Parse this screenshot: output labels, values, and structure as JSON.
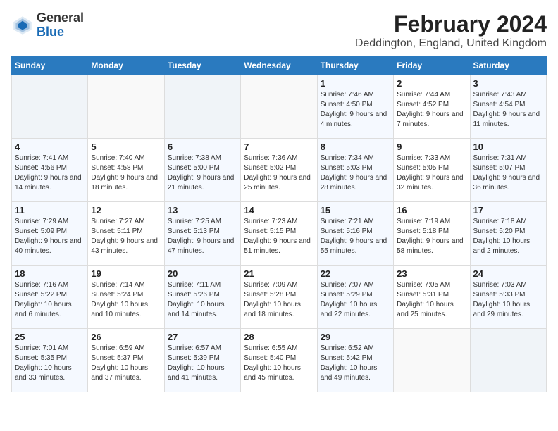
{
  "logo": {
    "general": "General",
    "blue": "Blue"
  },
  "title": {
    "month_year": "February 2024",
    "location": "Deddington, England, United Kingdom"
  },
  "days_of_week": [
    "Sunday",
    "Monday",
    "Tuesday",
    "Wednesday",
    "Thursday",
    "Friday",
    "Saturday"
  ],
  "weeks": [
    [
      {
        "day": "",
        "info": ""
      },
      {
        "day": "",
        "info": ""
      },
      {
        "day": "",
        "info": ""
      },
      {
        "day": "",
        "info": ""
      },
      {
        "day": "1",
        "info": "Sunrise: 7:46 AM\nSunset: 4:50 PM\nDaylight: 9 hours and 4 minutes."
      },
      {
        "day": "2",
        "info": "Sunrise: 7:44 AM\nSunset: 4:52 PM\nDaylight: 9 hours and 7 minutes."
      },
      {
        "day": "3",
        "info": "Sunrise: 7:43 AM\nSunset: 4:54 PM\nDaylight: 9 hours and 11 minutes."
      }
    ],
    [
      {
        "day": "4",
        "info": "Sunrise: 7:41 AM\nSunset: 4:56 PM\nDaylight: 9 hours and 14 minutes."
      },
      {
        "day": "5",
        "info": "Sunrise: 7:40 AM\nSunset: 4:58 PM\nDaylight: 9 hours and 18 minutes."
      },
      {
        "day": "6",
        "info": "Sunrise: 7:38 AM\nSunset: 5:00 PM\nDaylight: 9 hours and 21 minutes."
      },
      {
        "day": "7",
        "info": "Sunrise: 7:36 AM\nSunset: 5:02 PM\nDaylight: 9 hours and 25 minutes."
      },
      {
        "day": "8",
        "info": "Sunrise: 7:34 AM\nSunset: 5:03 PM\nDaylight: 9 hours and 28 minutes."
      },
      {
        "day": "9",
        "info": "Sunrise: 7:33 AM\nSunset: 5:05 PM\nDaylight: 9 hours and 32 minutes."
      },
      {
        "day": "10",
        "info": "Sunrise: 7:31 AM\nSunset: 5:07 PM\nDaylight: 9 hours and 36 minutes."
      }
    ],
    [
      {
        "day": "11",
        "info": "Sunrise: 7:29 AM\nSunset: 5:09 PM\nDaylight: 9 hours and 40 minutes."
      },
      {
        "day": "12",
        "info": "Sunrise: 7:27 AM\nSunset: 5:11 PM\nDaylight: 9 hours and 43 minutes."
      },
      {
        "day": "13",
        "info": "Sunrise: 7:25 AM\nSunset: 5:13 PM\nDaylight: 9 hours and 47 minutes."
      },
      {
        "day": "14",
        "info": "Sunrise: 7:23 AM\nSunset: 5:15 PM\nDaylight: 9 hours and 51 minutes."
      },
      {
        "day": "15",
        "info": "Sunrise: 7:21 AM\nSunset: 5:16 PM\nDaylight: 9 hours and 55 minutes."
      },
      {
        "day": "16",
        "info": "Sunrise: 7:19 AM\nSunset: 5:18 PM\nDaylight: 9 hours and 58 minutes."
      },
      {
        "day": "17",
        "info": "Sunrise: 7:18 AM\nSunset: 5:20 PM\nDaylight: 10 hours and 2 minutes."
      }
    ],
    [
      {
        "day": "18",
        "info": "Sunrise: 7:16 AM\nSunset: 5:22 PM\nDaylight: 10 hours and 6 minutes."
      },
      {
        "day": "19",
        "info": "Sunrise: 7:14 AM\nSunset: 5:24 PM\nDaylight: 10 hours and 10 minutes."
      },
      {
        "day": "20",
        "info": "Sunrise: 7:11 AM\nSunset: 5:26 PM\nDaylight: 10 hours and 14 minutes."
      },
      {
        "day": "21",
        "info": "Sunrise: 7:09 AM\nSunset: 5:28 PM\nDaylight: 10 hours and 18 minutes."
      },
      {
        "day": "22",
        "info": "Sunrise: 7:07 AM\nSunset: 5:29 PM\nDaylight: 10 hours and 22 minutes."
      },
      {
        "day": "23",
        "info": "Sunrise: 7:05 AM\nSunset: 5:31 PM\nDaylight: 10 hours and 25 minutes."
      },
      {
        "day": "24",
        "info": "Sunrise: 7:03 AM\nSunset: 5:33 PM\nDaylight: 10 hours and 29 minutes."
      }
    ],
    [
      {
        "day": "25",
        "info": "Sunrise: 7:01 AM\nSunset: 5:35 PM\nDaylight: 10 hours and 33 minutes."
      },
      {
        "day": "26",
        "info": "Sunrise: 6:59 AM\nSunset: 5:37 PM\nDaylight: 10 hours and 37 minutes."
      },
      {
        "day": "27",
        "info": "Sunrise: 6:57 AM\nSunset: 5:39 PM\nDaylight: 10 hours and 41 minutes."
      },
      {
        "day": "28",
        "info": "Sunrise: 6:55 AM\nSunset: 5:40 PM\nDaylight: 10 hours and 45 minutes."
      },
      {
        "day": "29",
        "info": "Sunrise: 6:52 AM\nSunset: 5:42 PM\nDaylight: 10 hours and 49 minutes."
      },
      {
        "day": "",
        "info": ""
      },
      {
        "day": "",
        "info": ""
      }
    ]
  ]
}
